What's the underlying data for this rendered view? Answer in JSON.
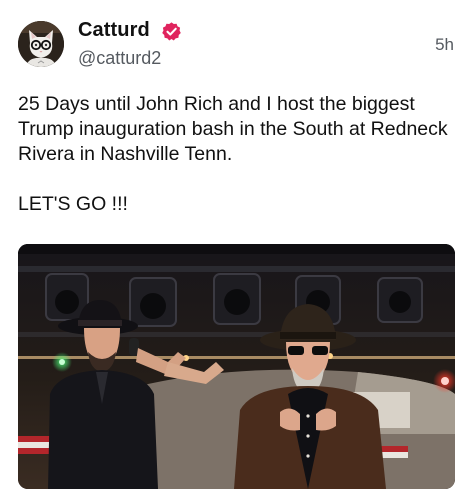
{
  "author": {
    "display_name": "Catturd",
    "handle": "@catturd2",
    "verified": true,
    "avatar_icon": "cat-avatar-icon",
    "verified_color": "#e0245e"
  },
  "post": {
    "timestamp": "5h",
    "text_main": "25 Days until John Rich and I host the biggest Trump inauguration bash in the South at Redneck Rivera in Nashville Tenn.",
    "text_cta": "LET'S GO !!!"
  },
  "media": {
    "type": "photo"
  }
}
